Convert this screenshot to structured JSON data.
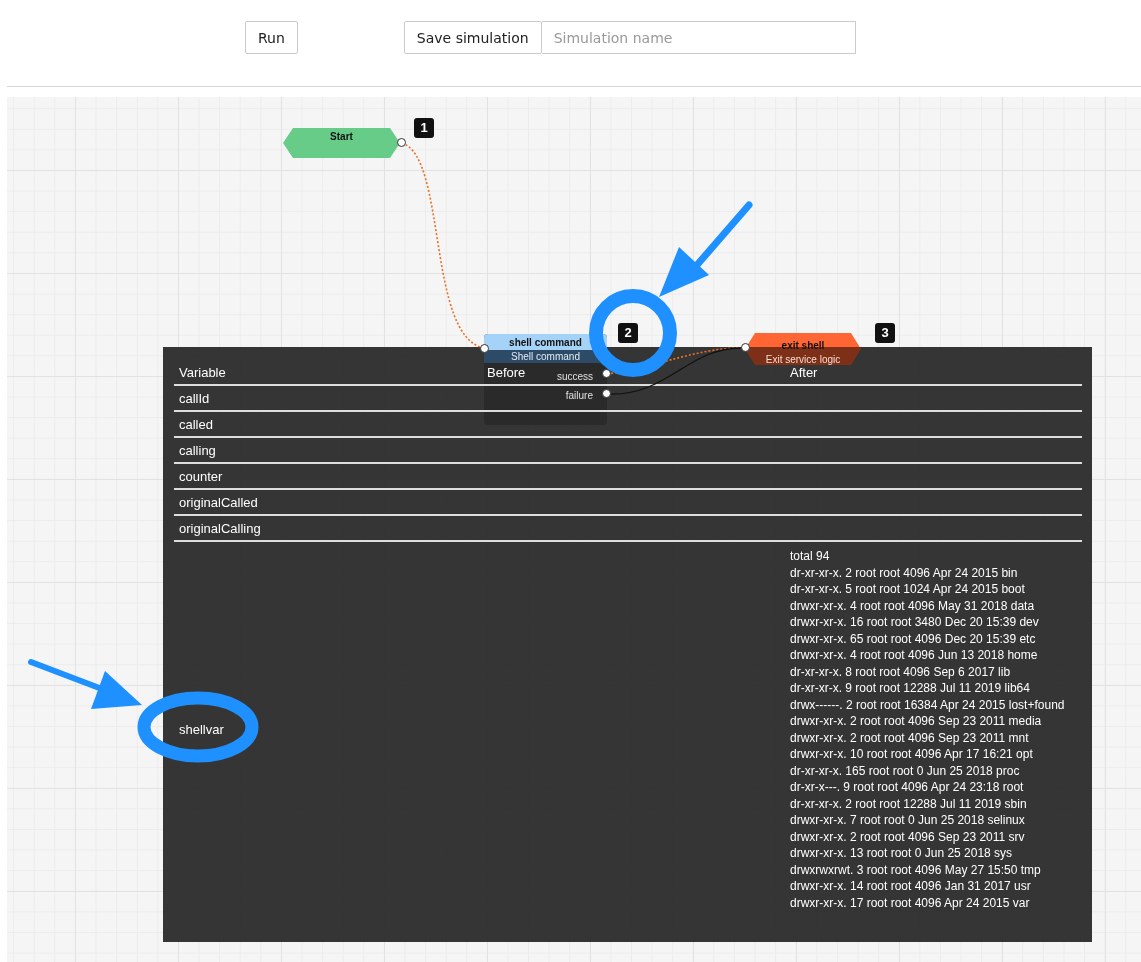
{
  "toolbar": {
    "run_button": "Run",
    "save_button": "Save simulation",
    "name_field": {
      "placeholder": "Simulation name"
    }
  },
  "flow": {
    "nodes": [
      {
        "kind": "start",
        "title": "Start",
        "badge": "1"
      },
      {
        "kind": "action",
        "title": "shell command",
        "subtitle": "Shell command",
        "badge": "2",
        "outputs": [
          "success",
          "failure"
        ]
      },
      {
        "kind": "exit",
        "title": "exit shell",
        "subtitle": "Exit service logic",
        "badge": "3"
      }
    ],
    "edges": [
      {
        "kind": "dotted"
      },
      {
        "kind": "dotted"
      },
      {
        "kind": "solid"
      }
    ]
  },
  "variables_panel": {
    "columns": [
      "Variable",
      "Before",
      "After"
    ],
    "rows": [
      {
        "variable": "callId"
      },
      {
        "variable": "called"
      },
      {
        "variable": "calling"
      },
      {
        "variable": "counter"
      },
      {
        "variable": "originalCalled"
      },
      {
        "variable": "originalCalling"
      },
      {
        "variable": "shellvar",
        "after": [
          "total 94",
          "dr-xr-xr-x. 2 root root 4096 Apr 24 2015 bin",
          "dr-xr-xr-x. 5 root root 1024 Apr 24 2015 boot",
          "drwxr-xr-x. 4 root root 4096 May 31 2018 data",
          "drwxr-xr-x. 16 root root 3480 Dec 20 15:39 dev",
          "drwxr-xr-x. 65 root root 4096 Dec 20 15:39 etc",
          "drwxr-xr-x. 4 root root 4096 Jun 13 2018 home",
          "dr-xr-xr-x. 8 root root 4096 Sep 6 2017 lib",
          "dr-xr-xr-x. 9 root root 12288 Jul 11 2019 lib64",
          "drwx------. 2 root root 16384 Apr 24 2015 lost+found",
          "drwxr-xr-x. 2 root root 4096 Sep 23 2011 media",
          "drwxr-xr-x. 2 root root 4096 Sep 23 2011 mnt",
          "drwxr-xr-x. 10 root root 4096 Apr 17 16:21 opt",
          "dr-xr-xr-x. 165 root root 0 Jun 25 2018 proc",
          "dr-xr-x---. 9 root root 4096 Apr 24 23:18 root",
          "dr-xr-xr-x. 2 root root 12288 Jul 11 2019 sbin",
          "drwxr-xr-x. 7 root root 0 Jun 25 2018 selinux",
          "drwxr-xr-x. 2 root root 4096 Sep 23 2011 srv",
          "drwxr-xr-x. 13 root root 0 Jun 25 2018 sys",
          "drwxrwxrwt. 3 root root 4096 May 27 15:50 tmp",
          "drwxr-xr-x. 14 root root 4096 Jan 31 2017 usr",
          "drwxr-xr-x. 17 root root 4096 Apr 24 2015 var"
        ]
      }
    ]
  }
}
